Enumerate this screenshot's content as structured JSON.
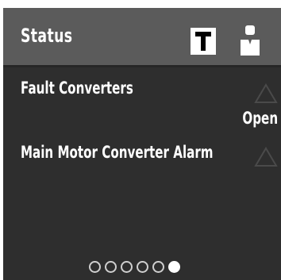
{
  "panel": {
    "title": "Status",
    "toolbar": {
      "t_icon": "text-t-icon",
      "user_icon": "user-icon"
    },
    "items": [
      {
        "label": "Fault Converters",
        "value": "Open",
        "icon": "warning-triangle-icon"
      },
      {
        "label": "Main Motor Converter Alarm",
        "icon": "warning-triangle-icon"
      }
    ],
    "pagination": {
      "total": 6,
      "active_index": 5
    }
  },
  "colors": {
    "panel_bg": "#2e2e2e",
    "header_bg": "#5b5b5b",
    "text": "#ffffff",
    "warning_icon": "#4a4a4a"
  }
}
